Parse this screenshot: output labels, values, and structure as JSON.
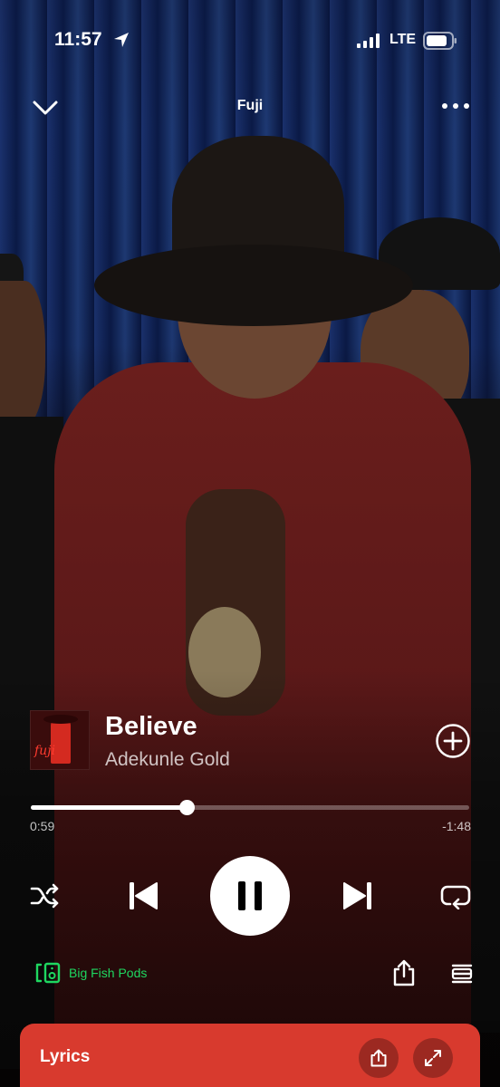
{
  "status_bar": {
    "time": "11:57",
    "network": "LTE"
  },
  "header": {
    "title": "Fuji"
  },
  "track": {
    "title": "Believe",
    "artist": "Adekunle Gold",
    "cover_text": "fuji"
  },
  "progress": {
    "elapsed": "0:59",
    "remaining": "-1:48",
    "fraction": 0.355
  },
  "device": {
    "name": "Big Fish Pods"
  },
  "lyrics": {
    "label": "Lyrics"
  },
  "colors": {
    "accent_green": "#1ed760",
    "lyrics_card": "#d83a2e"
  },
  "icons": {
    "collapse": "chevron-down-icon",
    "more": "more-dots-icon",
    "add": "add-circle-icon",
    "shuffle": "shuffle-icon",
    "previous": "skip-previous-icon",
    "pause": "pause-icon",
    "next": "skip-next-icon",
    "repeat": "repeat-icon",
    "device": "connect-device-icon",
    "share": "share-icon",
    "queue": "queue-icon",
    "expand": "expand-icon"
  }
}
